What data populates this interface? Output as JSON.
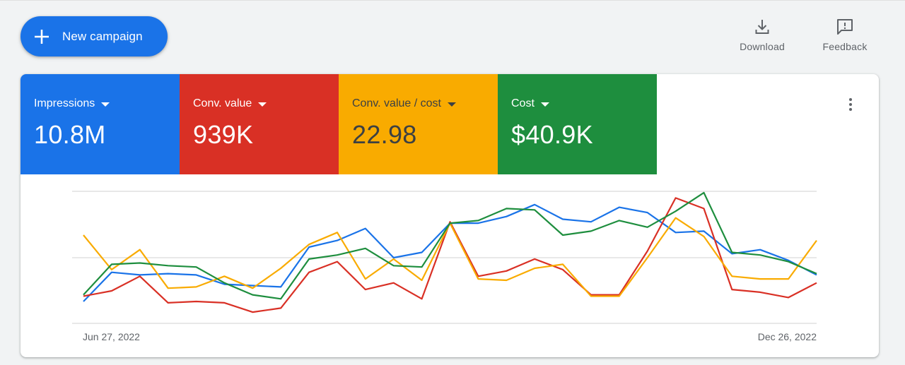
{
  "toolbar": {
    "new_campaign_label": "New campaign",
    "download_label": "Download",
    "feedback_label": "Feedback"
  },
  "metrics": [
    {
      "label": "Impressions",
      "value": "10.8M",
      "color": "#1a73e8"
    },
    {
      "label": "Conv. value",
      "value": "939K",
      "color": "#d93025"
    },
    {
      "label": "Conv. value / cost",
      "value": "22.98",
      "color": "#f9ab00"
    },
    {
      "label": "Cost",
      "value": "$40.9K",
      "color": "#1e8e3e"
    }
  ],
  "icons": {
    "new_campaign": "plus-icon",
    "download": "download-icon",
    "feedback": "feedback-icon",
    "more": "more-vert-icon"
  },
  "chart_data": {
    "type": "line",
    "x_start_label": "Jun 27, 2022",
    "x_end_label": "Dec 26, 2022",
    "ylim": [
      0,
      100
    ],
    "gridlines": 3,
    "series": [
      {
        "color": "#1a73e8",
        "values": [
          17,
          39,
          37,
          38,
          37,
          30,
          29,
          28,
          58,
          63,
          72,
          50,
          54,
          76,
          76,
          81,
          90,
          79,
          77,
          88,
          84,
          69,
          70,
          53,
          56,
          48,
          37
        ]
      },
      {
        "color": "#d93025",
        "values": [
          21,
          25,
          36,
          16,
          17,
          16,
          9,
          12,
          39,
          47,
          26,
          31,
          19,
          77,
          36,
          40,
          49,
          41,
          22,
          22,
          55,
          95,
          87,
          26,
          24,
          20,
          31
        ]
      },
      {
        "color": "#f9ab00",
        "values": [
          67,
          41,
          56,
          27,
          28,
          36,
          27,
          42,
          60,
          69,
          34,
          49,
          33,
          76,
          34,
          33,
          42,
          45,
          21,
          21,
          50,
          80,
          66,
          36,
          34,
          34,
          63
        ]
      },
      {
        "color": "#1e8e3e",
        "values": [
          22,
          45,
          46,
          44,
          43,
          31,
          22,
          19,
          49,
          52,
          57,
          44,
          43,
          76,
          78,
          87,
          86,
          67,
          70,
          78,
          73,
          85,
          99,
          54,
          52,
          47,
          38
        ]
      }
    ]
  }
}
